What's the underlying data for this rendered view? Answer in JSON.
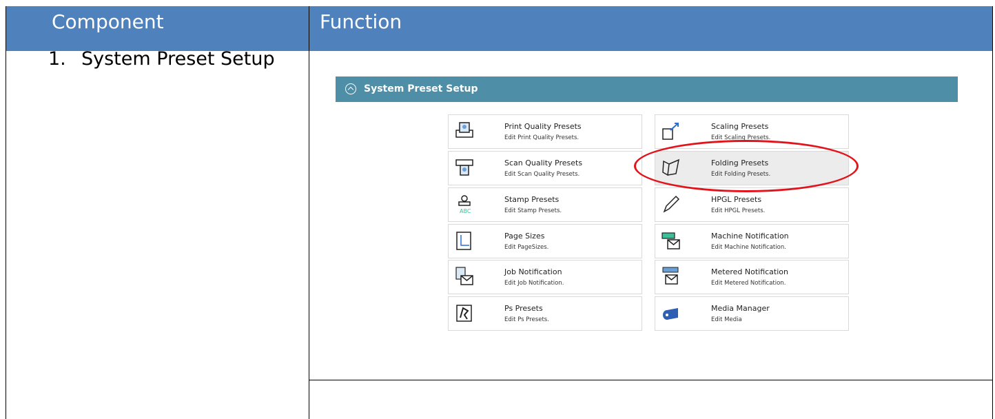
{
  "table": {
    "header": {
      "col1": "Component",
      "col2": "Function"
    },
    "row1": {
      "number": "1.",
      "component": "System Preset Setup"
    }
  },
  "panel": {
    "title": "System Preset Setup",
    "accent": "#4e8ea6",
    "cards": [
      {
        "title": "Print Quality Presets",
        "desc": "Edit Print Quality Presets.",
        "icon": "print-quality-icon"
      },
      {
        "title": "Scaling Presets",
        "desc": "Edit Scaling Presets.",
        "icon": "scaling-icon"
      },
      {
        "title": "Scan Quality Presets",
        "desc": "Edit Scan Quality Presets.",
        "icon": "scan-quality-icon"
      },
      {
        "title": "Folding Presets",
        "desc": "Edit Folding Presets.",
        "icon": "folding-icon",
        "highlighted": true
      },
      {
        "title": "Stamp Presets",
        "desc": "Edit Stamp Presets.",
        "icon": "stamp-icon"
      },
      {
        "title": "HPGL Presets",
        "desc": "Edit HPGL Presets.",
        "icon": "pen-icon"
      },
      {
        "title": "Page Sizes",
        "desc": "Edit PageSizes.",
        "icon": "page-size-icon"
      },
      {
        "title": "Machine Notification",
        "desc": "Edit Machine Notification.",
        "icon": "machine-notification-icon"
      },
      {
        "title": "Job Notification",
        "desc": "Edit Job Notification.",
        "icon": "job-notification-icon"
      },
      {
        "title": "Metered Notification",
        "desc": "Edit Metered Notification.",
        "icon": "metered-notification-icon"
      },
      {
        "title": "Ps Presets",
        "desc": "Edit Ps Presets.",
        "icon": "ps-icon"
      },
      {
        "title": "Media Manager",
        "desc": "Edit Media",
        "icon": "media-roll-icon"
      }
    ]
  },
  "colors": {
    "header": "#4f81bd",
    "highlight_ring": "#e1141b"
  }
}
